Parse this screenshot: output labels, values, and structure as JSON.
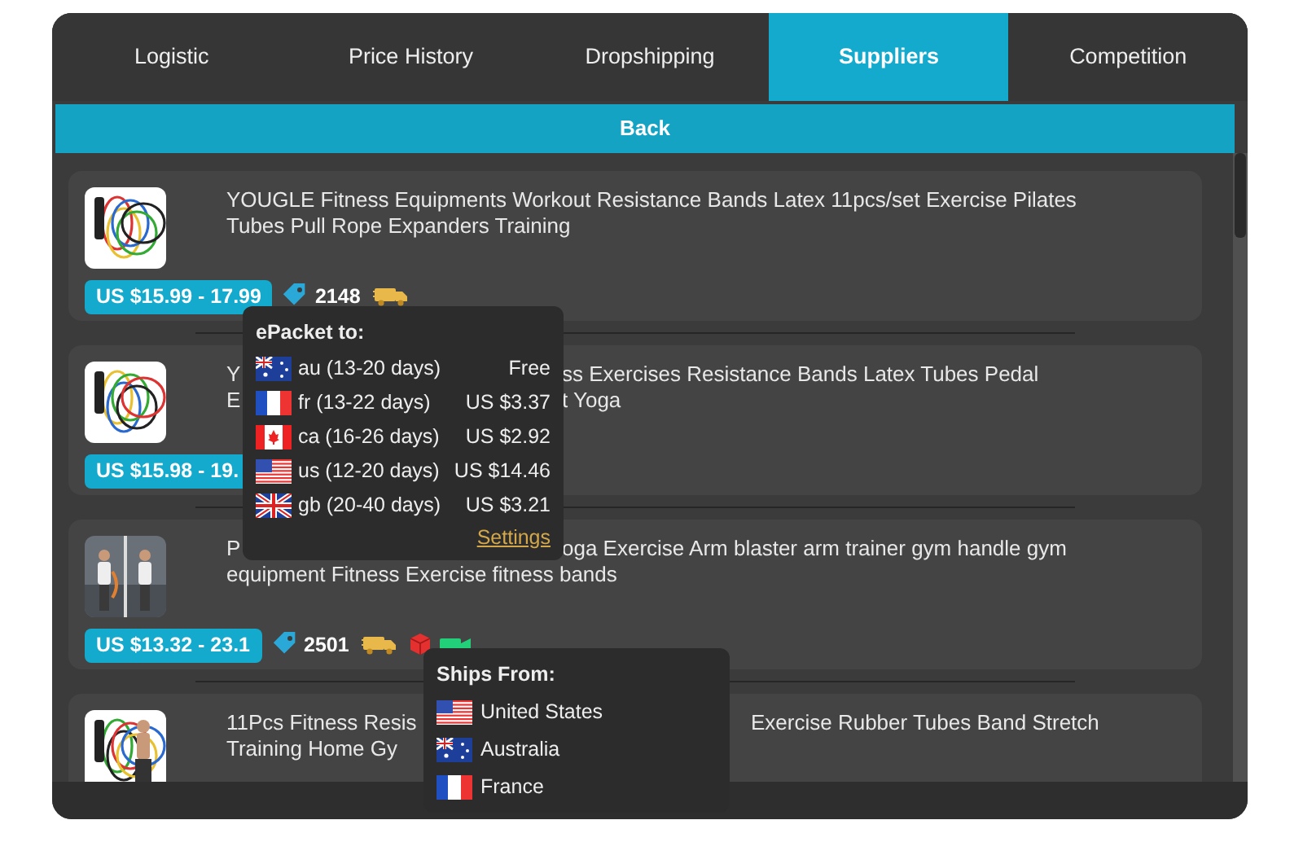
{
  "tabs": [
    {
      "label": "Logistic",
      "selected": false
    },
    {
      "label": "Price History",
      "selected": false
    },
    {
      "label": "Dropshipping",
      "selected": false
    },
    {
      "label": "Suppliers",
      "selected": true
    },
    {
      "label": "Competition",
      "selected": false
    }
  ],
  "back_button": "Back",
  "products": [
    {
      "title_lines": [
        {
          "text": "YOUGLE Fitness Equipments Workout Resistance Bands Latex 11pcs/set Exercise Pilates"
        },
        {
          "text": "Tubes Pull Rope Expanders Training"
        }
      ],
      "price": "US $15.99 - 17.99",
      "orders": "2148",
      "badges": [
        {
          "kind": "epacket"
        }
      ]
    },
    {
      "title_lines": [
        {
          "before": "Y",
          "after": "ss Exercises Resistance Bands Latex Tubes Pedal"
        },
        {
          "before": "E",
          "after": "t Yoga"
        }
      ],
      "price": "US $15.98 - 19."
    },
    {
      "title_lines": [
        {
          "before": "P",
          "after": "oga Exercise Arm blaster arm trainer gym handle gym"
        },
        {
          "text": "equipment Fitness Exercise fitness bands"
        }
      ],
      "price": "US $13.32 - 23.1",
      "orders": "2501",
      "badges": [
        {
          "kind": "epacket"
        },
        {
          "kind": "box"
        },
        {
          "kind": "video"
        }
      ]
    },
    {
      "title_lines": [
        {
          "before": "11Pcs Fitness Resis",
          "after": "Exercise Rubber Tubes Band Stretch"
        },
        {
          "before": "Training Home Gy"
        }
      ]
    }
  ],
  "epacket_popup": {
    "title": "ePacket to:",
    "settings": "Settings",
    "rows": [
      {
        "kind": "au",
        "label": "au (13-20 days)",
        "price": "Free"
      },
      {
        "kind": "fr",
        "label": "fr (13-22 days)",
        "price": "US $3.37"
      },
      {
        "kind": "ca",
        "label": "ca (16-26 days)",
        "price": "US $2.92"
      },
      {
        "kind": "us",
        "label": "us (12-20 days)",
        "price": "US $14.46"
      },
      {
        "kind": "gb",
        "label": "gb (20-40 days)",
        "price": "US $3.21"
      }
    ]
  },
  "ships_from_popup": {
    "title": "Ships From:",
    "rows": [
      {
        "kind": "us",
        "label": "United States"
      },
      {
        "kind": "au",
        "label": "Australia"
      },
      {
        "kind": "fr",
        "label": "France"
      }
    ]
  }
}
